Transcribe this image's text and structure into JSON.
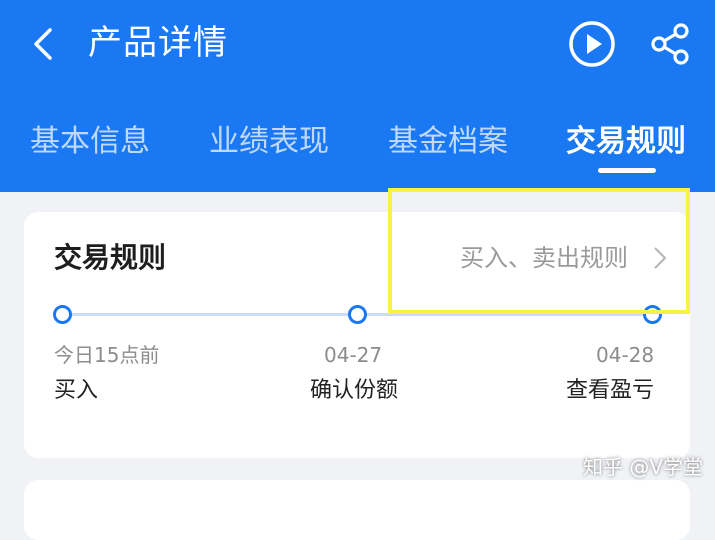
{
  "header": {
    "title": "产品详情",
    "background_color": "#1a78f2",
    "back_icon": "chevron-left-icon",
    "play_icon": "play-circle-icon",
    "share_icon": "share-icon"
  },
  "tabs": [
    {
      "label": "基本信息",
      "active": false
    },
    {
      "label": "业绩表现",
      "active": false
    },
    {
      "label": "基金档案",
      "active": false
    },
    {
      "label": "交易规则",
      "active": true
    }
  ],
  "trade_card": {
    "title": "交易规则",
    "rules_link": "买入、卖出规则",
    "steps": [
      {
        "date": "今日15点前",
        "label": "买入"
      },
      {
        "date": "04-27",
        "label": "确认份额"
      },
      {
        "date": "04-28",
        "label": "查看盈亏"
      }
    ]
  },
  "highlight_color": "#f6f24a",
  "watermark": "知乎 @V学堂"
}
